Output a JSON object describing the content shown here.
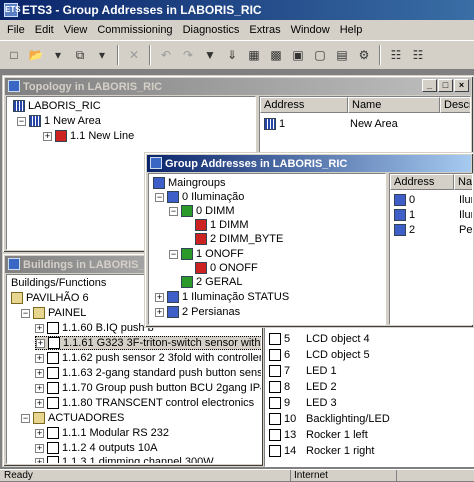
{
  "app": {
    "title": "ETS3 - Group Addresses in LABORIS_RIC",
    "icon_text": "ETS"
  },
  "menu": [
    {
      "id": "file",
      "label": "File"
    },
    {
      "id": "edit",
      "label": "Edit"
    },
    {
      "id": "view",
      "label": "View"
    },
    {
      "id": "commissioning",
      "label": "Commissioning"
    },
    {
      "id": "diagnostics",
      "label": "Diagnostics"
    },
    {
      "id": "extras",
      "label": "Extras"
    },
    {
      "id": "window",
      "label": "Window"
    },
    {
      "id": "help",
      "label": "Help"
    }
  ],
  "toolbar": [
    "new-icon",
    "open-icon",
    "dropdown-icon",
    "copy-icon",
    "dropdown-icon",
    "delete-icon",
    "undo-icon",
    "redo-icon",
    "filter-icon",
    "download-icon",
    "properties-icon",
    "topology-icon",
    "building-icon",
    "group-icon",
    "catalog-icon",
    "settings-icon",
    "report-icon"
  ],
  "topology": {
    "title": "Topology in LABORIS_RIC",
    "tree": [
      {
        "label": "LABORIS_RIC",
        "icon": "grid"
      },
      {
        "label": "1 New Area",
        "icon": "grid"
      },
      {
        "label": "1.1 New Line",
        "icon": "red"
      }
    ],
    "columns": [
      "Address",
      "Name",
      "Descri"
    ],
    "rows": [
      {
        "address": "1",
        "name": "New Area"
      }
    ]
  },
  "buildings": {
    "title": "Buildings in LABORIS_RIC",
    "heading": "Buildings/Functions",
    "tree": [
      {
        "label": "PAVILHÃO 6",
        "icon": "fold"
      },
      {
        "label": "PAINEL",
        "icon": "fold"
      },
      {
        "label": "1.1.60 B.IQ push b",
        "icon": "dev"
      },
      {
        "label": "1.1.61 G323 3F-triton-switch sensor with LC",
        "icon": "dev"
      },
      {
        "label": "1.1.62 push sensor 2 3fold with controller",
        "icon": "dev"
      },
      {
        "label": "1.1.63 2-gang standard push button sensor",
        "icon": "dev"
      },
      {
        "label": "1.1.70 Group push button BCU 2gang IP44",
        "icon": "dev"
      },
      {
        "label": "1.1.80 TRANSCENT control electronics",
        "icon": "dev"
      },
      {
        "label": "ACTUADORES",
        "icon": "fold"
      },
      {
        "label": "1.1.1 Modular RS 232",
        "icon": "dev"
      },
      {
        "label": "1.1.2 4 outputs 10A",
        "icon": "dev"
      },
      {
        "label": "1.1.3 1 dimming channel 300W",
        "icon": "dev"
      }
    ]
  },
  "objects": {
    "rows": [
      {
        "num": "5",
        "name": "LCD object 4"
      },
      {
        "num": "6",
        "name": "LCD object 5"
      },
      {
        "num": "7",
        "name": "LED 1"
      },
      {
        "num": "8",
        "name": "LED 2"
      },
      {
        "num": "9",
        "name": "LED 3"
      },
      {
        "num": "10",
        "name": "Backlighting/LED"
      },
      {
        "num": "13",
        "name": "Rocker 1 left"
      },
      {
        "num": "14",
        "name": "Rocker 1 right"
      }
    ]
  },
  "groups": {
    "title": "Group Addresses in LABORIS_RIC",
    "tree": [
      {
        "label": "Maingroups",
        "icon": "blue"
      },
      {
        "label": "0 Iluminação",
        "icon": "blue"
      },
      {
        "label": "0 DIMM",
        "icon": "green"
      },
      {
        "label": "1 DIMM",
        "icon": "red"
      },
      {
        "label": "2 DIMM_BYTE",
        "icon": "red"
      },
      {
        "label": "1 ONOFF",
        "icon": "green"
      },
      {
        "label": "0 ONOFF",
        "icon": "red"
      },
      {
        "label": "2 GERAL",
        "icon": "green"
      },
      {
        "label": "1 Iluminação STATUS",
        "icon": "blue"
      },
      {
        "label": "2 Persianas",
        "icon": "blue"
      }
    ],
    "columns": [
      "Address",
      "Na"
    ],
    "rows": [
      {
        "address": "0",
        "name": "Ilumi"
      },
      {
        "address": "1",
        "name": "Ilumi"
      },
      {
        "address": "2",
        "name": "Persi"
      }
    ]
  },
  "status": {
    "left": "Ready",
    "middle": "Internet"
  }
}
